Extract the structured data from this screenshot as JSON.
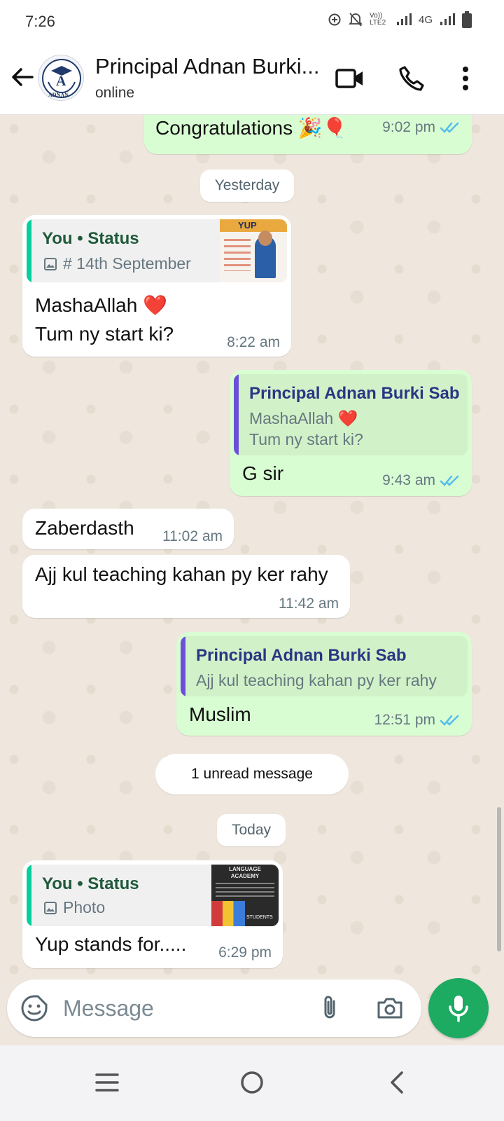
{
  "status_bar": {
    "time": "7:26",
    "volte": "Vo)) LTE2",
    "network": "4G"
  },
  "header": {
    "contact_name": "Principal Adnan Burki...",
    "status": "online",
    "avatar_text": "A",
    "avatar_caption": "ADNAN"
  },
  "chat": {
    "messages": [
      {
        "direction": "out",
        "text": "Congratulations 🎉🎈",
        "time": "9:02 pm"
      },
      {
        "type": "date_chip",
        "text": "Yesterday"
      },
      {
        "direction": "in",
        "quote_title": "You • Status",
        "quote_sub": "# 14th September",
        "thumb_text": "YUP",
        "line1": "MashaAllah ❤️",
        "line2": "Tum ny start ki?",
        "time": "8:22 am"
      },
      {
        "direction": "out",
        "quote_title": "Principal Adnan Burki Sab",
        "quote_line1": "MashaAllah ❤️",
        "quote_line2": "Tum ny start ki?",
        "text": "G sir",
        "time": "9:43 am"
      },
      {
        "direction": "in",
        "text": "Zaberdasth",
        "time": "11:02 am"
      },
      {
        "direction": "in",
        "text": "Ajj kul teaching kahan py ker rahy",
        "time": "11:42 am"
      },
      {
        "direction": "out",
        "quote_title": "Principal Adnan Burki Sab",
        "quote_line1": "Ajj kul teaching kahan py ker rahy",
        "text": "Muslim",
        "time": "12:51 pm"
      },
      {
        "type": "unread_chip",
        "text": "1 unread message"
      },
      {
        "type": "date_chip",
        "text": "Today"
      },
      {
        "direction": "in",
        "quote_title": "You • Status",
        "quote_sub": "Photo",
        "thumb_text": "LANGUAGE ACADEMY",
        "thumb_text2": "STUDENTS",
        "text": "Yup stands for.....",
        "time": "6:29 pm"
      }
    ]
  },
  "composer": {
    "placeholder": "Message"
  },
  "colors": {
    "accent": "#1daa61",
    "outgoing_bubble": "#d9fdd3",
    "incoming_bubble": "#ffffff",
    "read_ticks": "#53bdeb",
    "status_quote_bar": "#06cf9c",
    "contact_quote_bar": "#6b4fd8"
  }
}
